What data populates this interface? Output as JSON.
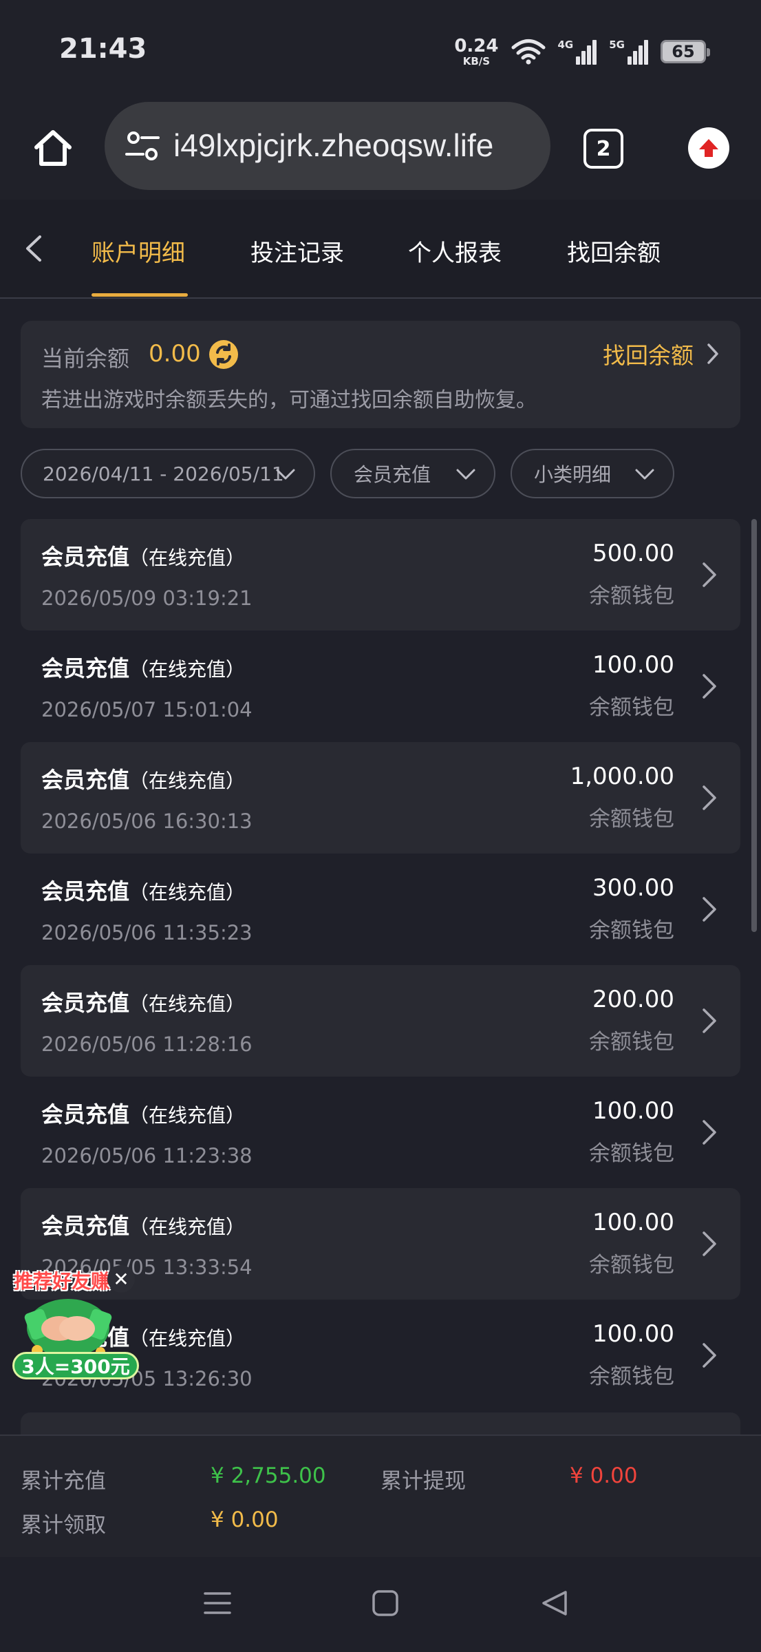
{
  "status_bar": {
    "time": "21:43",
    "net_speed_value": "0.24",
    "net_speed_unit": "KB/S",
    "signal_1_tag": "4G",
    "signal_2_tag": "5G",
    "battery": "65"
  },
  "browser": {
    "url": "i49lxpjcjrk.zheoqsw.life",
    "tab_count": "2"
  },
  "tabs": [
    {
      "label": "账户明细",
      "active": true
    },
    {
      "label": "投注记录",
      "active": false
    },
    {
      "label": "个人报表",
      "active": false
    },
    {
      "label": "找回余额",
      "active": false
    }
  ],
  "balance": {
    "label": "当前余额",
    "value": "0.00",
    "recover_label": "找回余额",
    "hint": "若进出游戏时余额丢失的，可通过找回余额自助恢复。"
  },
  "filters": {
    "date_range": "2026/04/11 - 2026/05/11",
    "type": "会员充值",
    "subtype": "小类明细"
  },
  "records": [
    {
      "title": "会员充值",
      "subtitle": "（在线充值）",
      "time": "2026/05/09 03:19:21",
      "amount": "500.00",
      "wallet": "余额钱包"
    },
    {
      "title": "会员充值",
      "subtitle": "（在线充值）",
      "time": "2026/05/07 15:01:04",
      "amount": "100.00",
      "wallet": "余额钱包"
    },
    {
      "title": "会员充值",
      "subtitle": "（在线充值）",
      "time": "2026/05/06 16:30:13",
      "amount": "1,000.00",
      "wallet": "余额钱包"
    },
    {
      "title": "会员充值",
      "subtitle": "（在线充值）",
      "time": "2026/05/06 11:35:23",
      "amount": "300.00",
      "wallet": "余额钱包"
    },
    {
      "title": "会员充值",
      "subtitle": "（在线充值）",
      "time": "2026/05/06 11:28:16",
      "amount": "200.00",
      "wallet": "余额钱包"
    },
    {
      "title": "会员充值",
      "subtitle": "（在线充值）",
      "time": "2026/05/06 11:23:38",
      "amount": "100.00",
      "wallet": "余额钱包"
    },
    {
      "title": "会员充值",
      "subtitle": "（在线充值）",
      "time": "2026/05/05 13:33:54",
      "amount": "100.00",
      "wallet": "余额钱包"
    },
    {
      "title": "会员充值",
      "subtitle": "（在线充值）",
      "time": "2026/05/05 13:26:30",
      "amount": "100.00",
      "wallet": "余额钱包"
    }
  ],
  "promo": {
    "top_text": "推荐好友赚",
    "bottom_text": "3人=300元"
  },
  "summary": {
    "total_deposit_label": "累计充值",
    "total_deposit_value": "¥ 2,755.00",
    "total_withdraw_label": "累计提现",
    "total_withdraw_value": "¥ 0.00",
    "total_claimed_label": "累计领取",
    "total_claimed_value": "¥ 0.00"
  },
  "colors": {
    "accent": "#f2bb4a",
    "deposit": "#3ec24a",
    "withdraw": "#f0443c",
    "background": "#1f2029"
  }
}
